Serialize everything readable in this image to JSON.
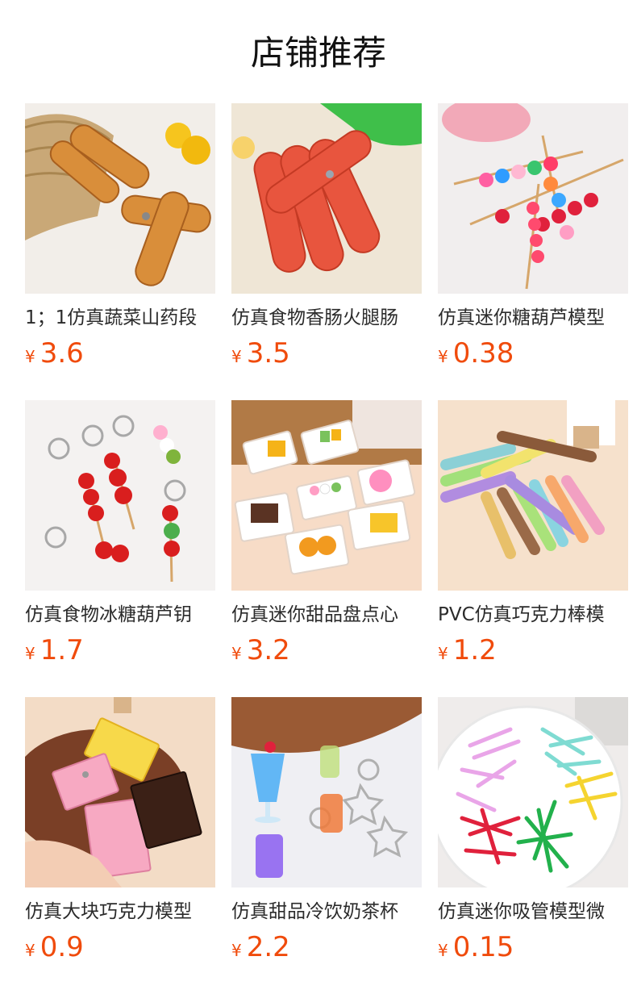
{
  "page": {
    "title": "店铺推荐"
  },
  "colors": {
    "price": "#f04b0c",
    "text": "#2b2b2b"
  },
  "products": [
    {
      "name": "1；1仿真蔬菜山药段",
      "currency": "¥",
      "price": "3.6",
      "image": "yam-slices-photo"
    },
    {
      "name": "仿真食物香肠火腿肠",
      "currency": "¥",
      "price": "3.5",
      "image": "sausages-photo"
    },
    {
      "name": "仿真迷你糖葫芦模型",
      "currency": "¥",
      "price": "0.38",
      "image": "candied-haws-photo"
    },
    {
      "name": "仿真食物冰糖葫芦钥",
      "currency": "¥",
      "price": "1.7",
      "image": "haws-keychain-photo"
    },
    {
      "name": "仿真迷你甜品盘点心",
      "currency": "¥",
      "price": "3.2",
      "image": "dessert-plates-photo"
    },
    {
      "name": "PVC仿真巧克力棒模",
      "currency": "¥",
      "price": "1.2",
      "image": "chocolate-sticks-photo"
    },
    {
      "name": "仿真大块巧克力模型",
      "currency": "¥",
      "price": "0.9",
      "image": "chocolate-bars-photo"
    },
    {
      "name": "仿真甜品冷饮奶茶杯",
      "currency": "¥",
      "price": "2.2",
      "image": "drink-keychain-photo"
    },
    {
      "name": "仿真迷你吸管模型微",
      "currency": "¥",
      "price": "0.15",
      "image": "straws-plate-photo"
    }
  ]
}
